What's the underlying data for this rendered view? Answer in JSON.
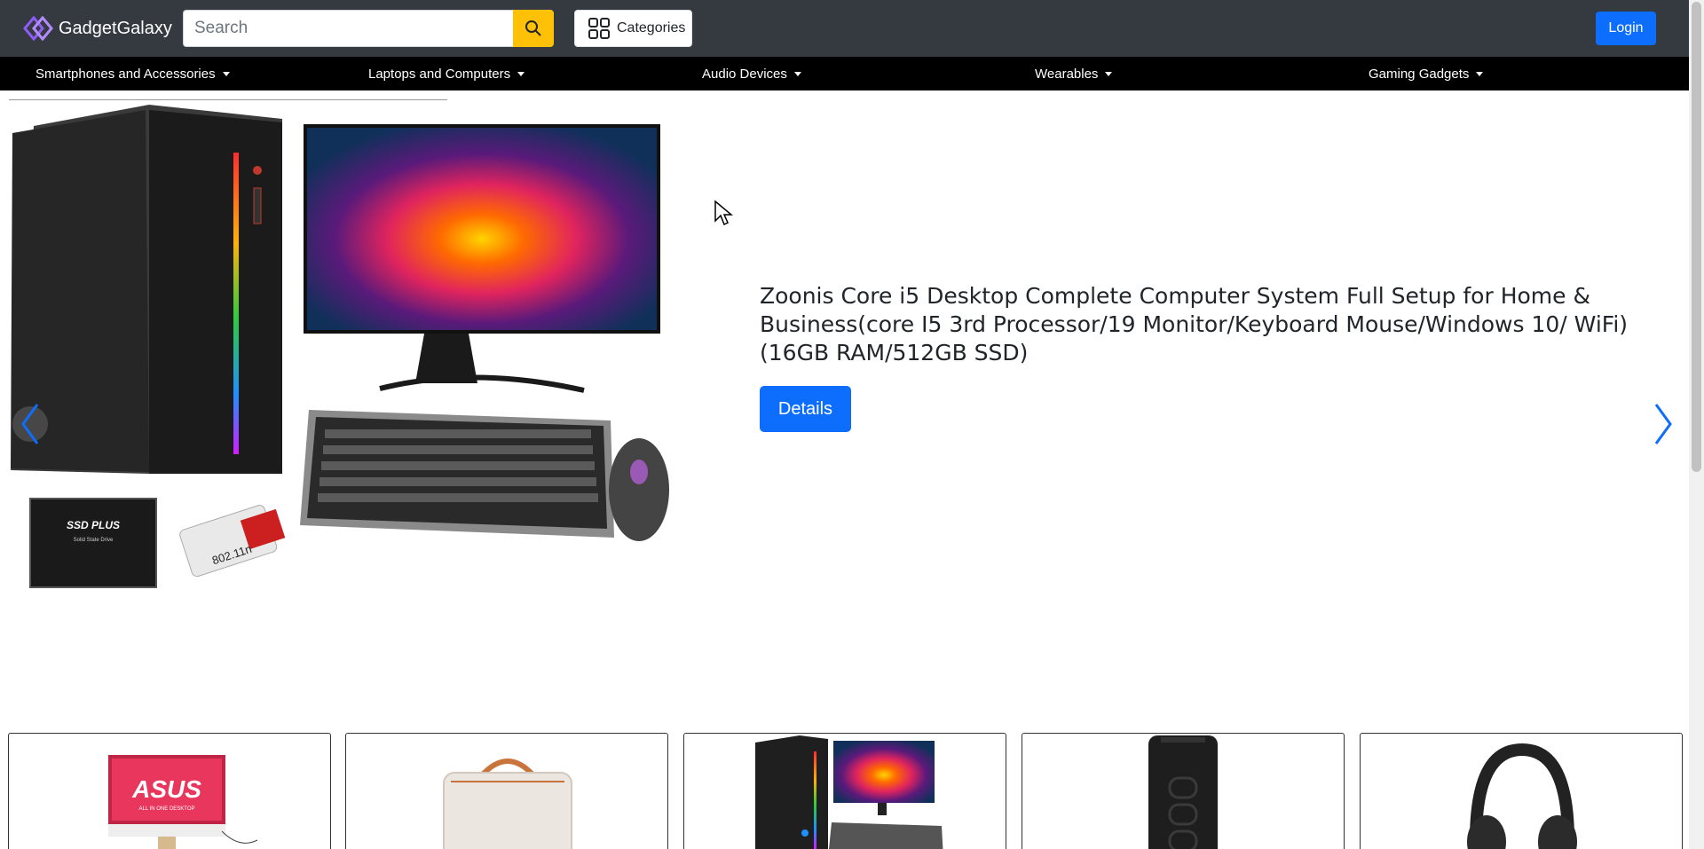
{
  "header": {
    "brand_name": "GadgetGalaxy",
    "search_placeholder": "Search",
    "categories_label": "Categories",
    "login_label": "Login",
    "accent_color": "#0d6efd",
    "search_button_color": "#ffc107"
  },
  "nav": {
    "items": [
      {
        "label": "Smartphones and Accessories"
      },
      {
        "label": "Laptops and Computers"
      },
      {
        "label": "Audio Devices"
      },
      {
        "label": "Wearables"
      },
      {
        "label": "Gaming Gadgets"
      }
    ]
  },
  "carousel": {
    "title": "Zoonis Core i5 Desktop Complete Computer System Full Setup for Home & Business(core I5 3rd Processor/19 Monitor/Keyboard Mouse/Windows 10/ WiFi) (16GB RAM/512GB SSD)",
    "details_label": "Details",
    "ssd_label": "SSD PLUS",
    "ssd_sublabel": "Solid State Drive",
    "wifi_label": "802.11n"
  },
  "cards": [
    {
      "icon": "asus-monitor-image",
      "brand_text": "ASUS",
      "sub_text": "ALL IN ONE DESKTOP"
    },
    {
      "icon": "laptop-bag-image"
    },
    {
      "icon": "desktop-setup-image"
    },
    {
      "icon": "power-bank-image"
    },
    {
      "icon": "headphones-image"
    }
  ]
}
